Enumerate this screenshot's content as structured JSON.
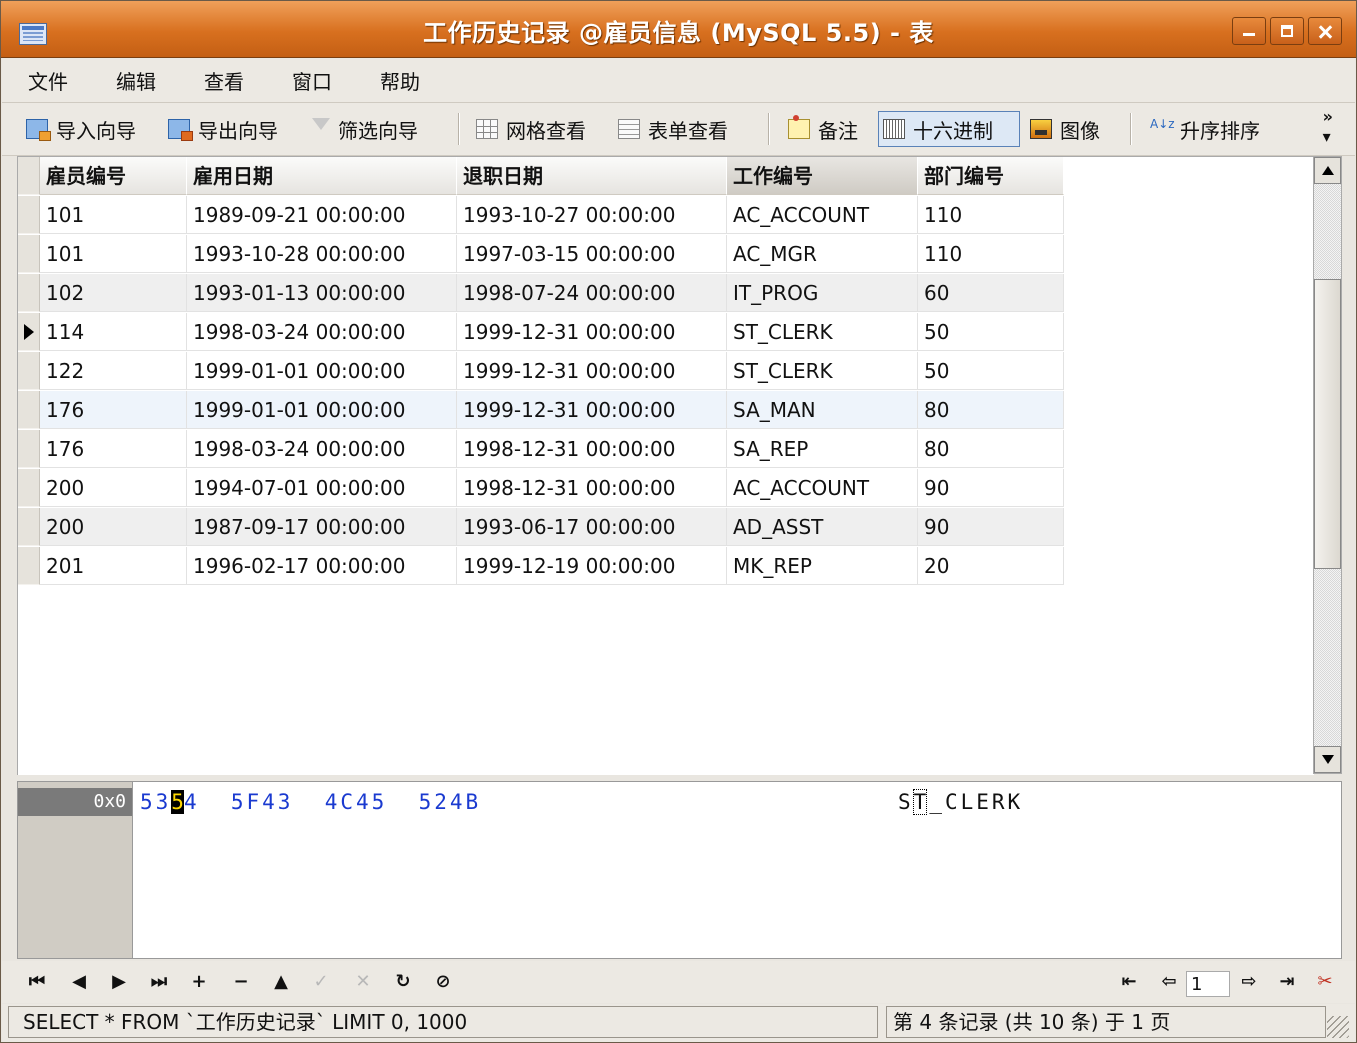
{
  "window": {
    "title": "工作历史记录 @雇员信息 (MySQL 5.5) - 表"
  },
  "menu": [
    "文件",
    "编辑",
    "查看",
    "窗口",
    "帮助"
  ],
  "toolbar": {
    "import": "导入向导",
    "export": "导出向导",
    "filter": "筛选向导",
    "grid_view": "网格查看",
    "form_view": "表单查看",
    "memo": "备注",
    "hex": "十六进制",
    "image": "图像",
    "sort_asc": "升序排序",
    "overflow": "»"
  },
  "table": {
    "columns": [
      "雇员编号",
      "雇用日期",
      "退职日期",
      "工作编号",
      "部门编号"
    ],
    "sorted_column_index": 3,
    "current_row_index": 3,
    "rows": [
      [
        "101",
        "1989-09-21 00:00:00",
        "1993-10-27 00:00:00",
        "AC_ACCOUNT",
        "110"
      ],
      [
        "101",
        "1993-10-28 00:00:00",
        "1997-03-15 00:00:00",
        "AC_MGR",
        "110"
      ],
      [
        "102",
        "1993-01-13 00:00:00",
        "1998-07-24 00:00:00",
        "IT_PROG",
        "60"
      ],
      [
        "114",
        "1998-03-24 00:00:00",
        "1999-12-31 00:00:00",
        "ST_CLERK",
        "50"
      ],
      [
        "122",
        "1999-01-01 00:00:00",
        "1999-12-31 00:00:00",
        "ST_CLERK",
        "50"
      ],
      [
        "176",
        "1999-01-01 00:00:00",
        "1999-12-31 00:00:00",
        "SA_MAN",
        "80"
      ],
      [
        "176",
        "1998-03-24 00:00:00",
        "1998-12-31 00:00:00",
        "SA_REP",
        "80"
      ],
      [
        "200",
        "1994-07-01 00:00:00",
        "1998-12-31 00:00:00",
        "AC_ACCOUNT",
        "90"
      ],
      [
        "200",
        "1987-09-17 00:00:00",
        "1993-06-17 00:00:00",
        "AD_ASST",
        "90"
      ],
      [
        "201",
        "1996-02-17 00:00:00",
        "1999-12-19 00:00:00",
        "MK_REP",
        "20"
      ]
    ]
  },
  "hex": {
    "offset": "0x0",
    "bytes_before": "53",
    "bytes_cursor": "5",
    "bytes_after": "4  5F43  4C45  524B",
    "ascii_before": "S",
    "ascii_cursor": "T",
    "ascii_after": "_CLERK"
  },
  "navigator": {
    "page_value": "1"
  },
  "status": {
    "sql": "SELECT * FROM `工作历史记录` LIMIT 0, 1000",
    "record_info": "第 4 条记录 (共 10 条) 于 1 页"
  },
  "colors": {
    "titlebar": "#d8701f",
    "hex_bytes": "#1a3ad0",
    "hex_cursor_bg": "#000000",
    "hex_cursor_fg": "#ffd800"
  }
}
